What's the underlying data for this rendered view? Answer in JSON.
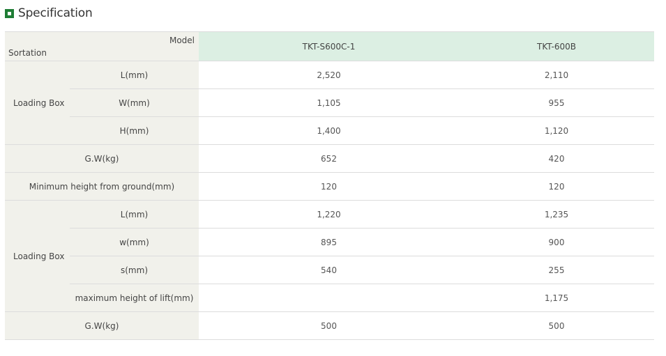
{
  "title": "Specification",
  "header": {
    "model_label": "Model",
    "sortation_label": "Sortation",
    "models": [
      "TKT-S600C-1",
      "TKT-600B"
    ]
  },
  "rows": {
    "box1_group": "Loading Box",
    "r1": {
      "label": "L(mm)",
      "v1": "2,520",
      "v2": "2,110"
    },
    "r2": {
      "label": "W(mm)",
      "v1": "1,105",
      "v2": "955"
    },
    "r3": {
      "label": "H(mm)",
      "v1": "1,400",
      "v2": "1,120"
    },
    "r4": {
      "label": "G.W(kg)",
      "v1": "652",
      "v2": "420"
    },
    "r5": {
      "label": "Minimum height from ground(mm)",
      "v1": "120",
      "v2": "120"
    },
    "box2_group": "Loading Box",
    "r6": {
      "label": "L(mm)",
      "v1": "1,220",
      "v2": "1,235"
    },
    "r7": {
      "label": "w(mm)",
      "v1": "895",
      "v2": "900"
    },
    "r8": {
      "label": "s(mm)",
      "v1": "540",
      "v2": "255"
    },
    "r9": {
      "label": "maximum height of lift(mm)",
      "v1": "",
      "v2": "1,175"
    },
    "r10": {
      "label": "G.W(kg)",
      "v1": "500",
      "v2": "500"
    }
  },
  "colors": {
    "accent": "#1f7d35",
    "label_bg": "#f1f1eb",
    "model_header_bg": "#dcefe3"
  }
}
